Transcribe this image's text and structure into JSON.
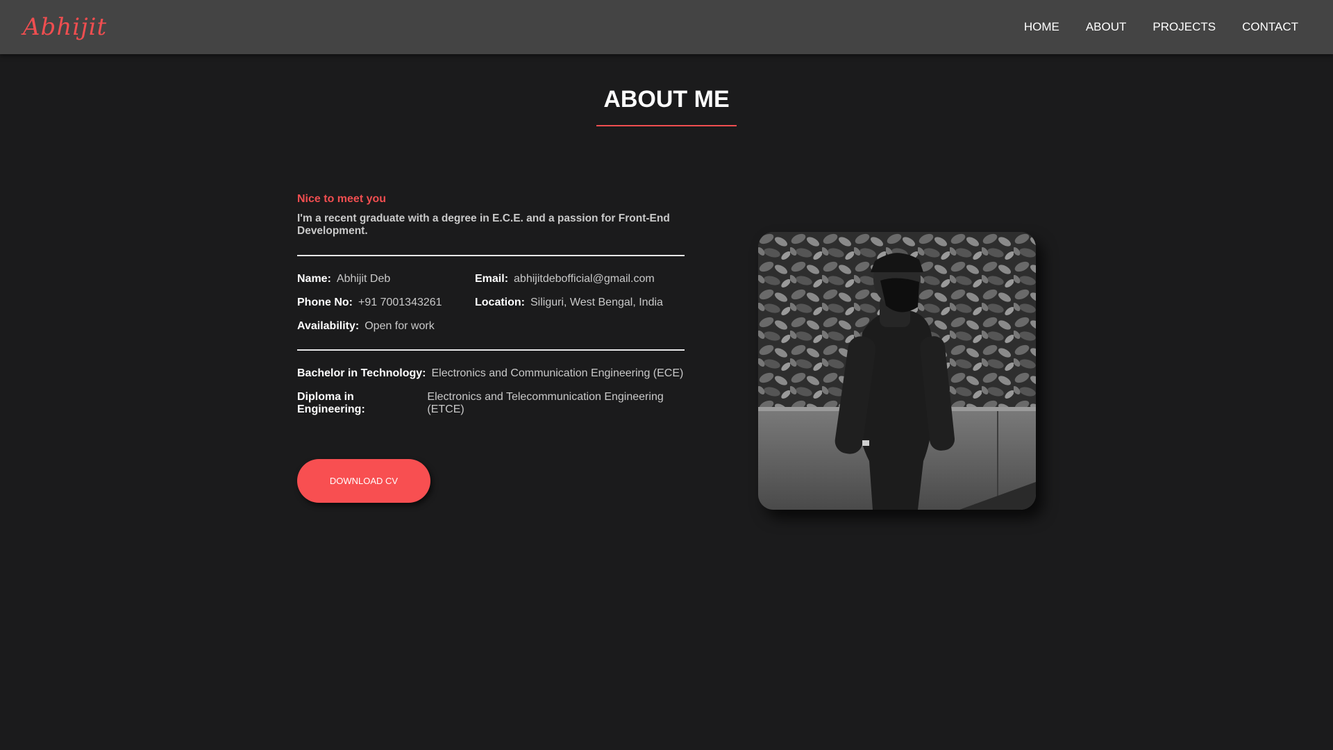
{
  "header": {
    "logo": "Abhijit",
    "nav": [
      "HOME",
      "ABOUT",
      "PROJECTS",
      "CONTACT"
    ]
  },
  "about": {
    "title": "ABOUT ME",
    "greeting": "Nice to meet you",
    "intro": "I'm a recent graduate with a degree in E.C.E. and a passion for Front-End Development.",
    "details": {
      "name_label": "Name:",
      "name_value": "Abhijit Deb",
      "email_label": "Email:",
      "email_value": "abhijitdebofficial@gmail.com",
      "phone_label": "Phone No:",
      "phone_value": "+91 7001343261",
      "location_label": "Location:",
      "location_value": "Siliguri, West Bengal, India",
      "availability_label": "Availability:",
      "availability_value": "Open for work"
    },
    "education": {
      "btech_label": "Bachelor in Technology:",
      "btech_value": "Electronics and Communication Engineering (ECE)",
      "diploma_label": "Diploma in Engineering:",
      "diploma_value": "Electronics and Telecommunication Engineering (ETCE)"
    },
    "cv_button": "DOWNLOAD CV"
  },
  "colors": {
    "accent": "#f04e50",
    "background": "#1b1b1c",
    "header": "#444444"
  }
}
